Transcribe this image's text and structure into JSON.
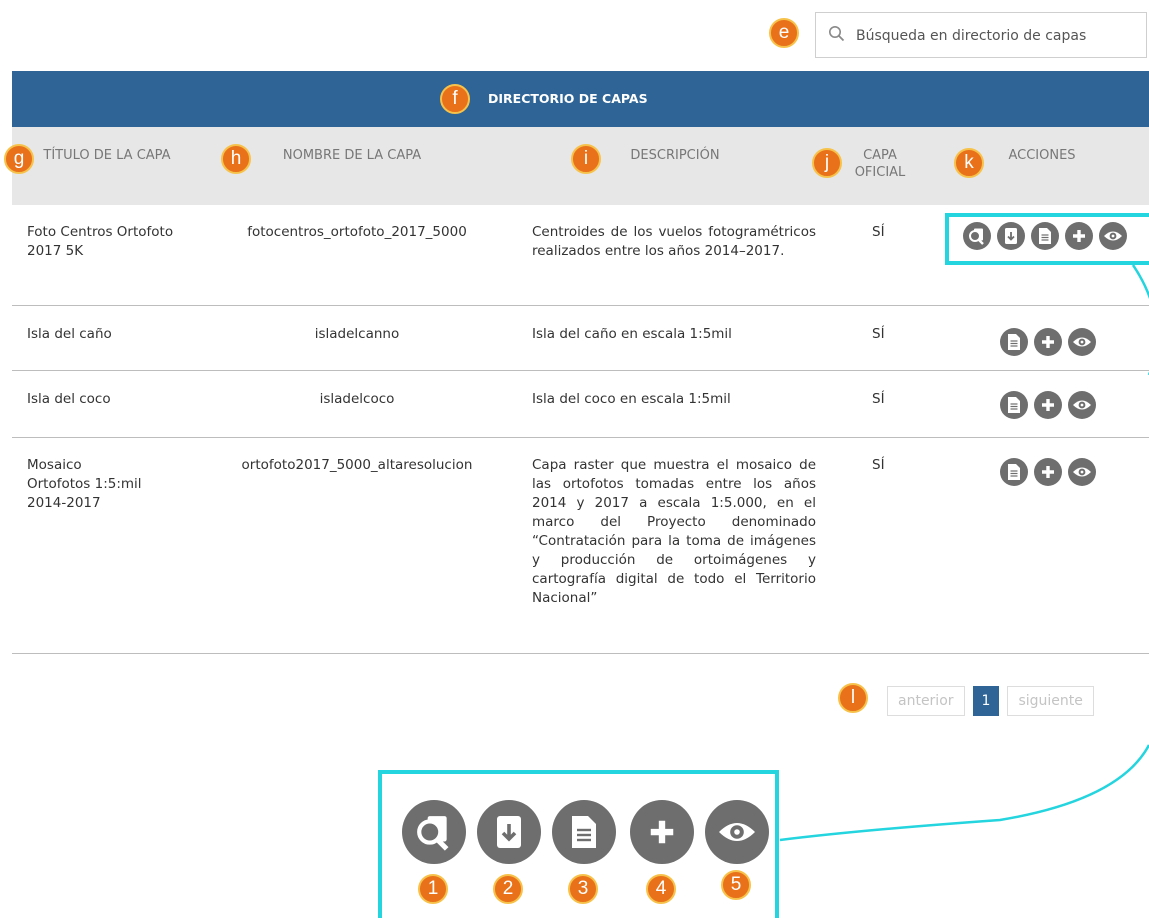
{
  "search": {
    "placeholder": "Búsqueda en directorio de capas",
    "value": ""
  },
  "directory": {
    "title": "DIRECTORIO DE CAPAS"
  },
  "columns": {
    "title": "TÍTULO DE LA CAPA",
    "name": "NOMBRE DE LA CAPA",
    "description": "DESCRIPCIÓN",
    "official": "CAPA OFICIAL",
    "actions": "ACCIONES"
  },
  "rows": [
    {
      "title": "Foto Centros Ortofoto 2017 5K",
      "name": "fotocentros_ortofoto_2017_5000",
      "description": "Centroides de los vuelos fotogramétricos realizados entre los años 2014–2017.",
      "official": "SÍ",
      "actions": [
        "metadata-search",
        "download",
        "document",
        "add",
        "view"
      ]
    },
    {
      "title": "Isla del caño",
      "name": "isladelcanno",
      "description": "Isla del caño en escala 1:5mil",
      "official": "SÍ",
      "actions": [
        "document",
        "add",
        "view"
      ]
    },
    {
      "title": "Isla del coco",
      "name": "isladelcoco",
      "description": "Isla del coco en escala 1:5mil",
      "official": "SÍ",
      "actions": [
        "document",
        "add",
        "view"
      ]
    },
    {
      "title": "Mosaico Ortofotos 1:5:mil 2014-2017",
      "name": "ortofoto2017_5000_altaresolucion",
      "description": "Capa raster que muestra el mosaico de las ortofotos tomadas entre los años 2014 y 2017 a escala 1:5.000, en el marco del Proyecto denominado “Contratación para la toma de imágenes y producción de ortoimágenes y cartografía digital de todo el Territorio Nacional”",
      "official": "SÍ",
      "actions": [
        "document",
        "add",
        "view"
      ]
    }
  ],
  "pagination": {
    "previous": "anterior",
    "current": "1",
    "next": "siguiente"
  },
  "callouts": {
    "e": "e",
    "f": "f",
    "g": "g",
    "h": "h",
    "i": "i",
    "j": "j",
    "k": "k",
    "l": "l",
    "legend": [
      "1",
      "2",
      "3",
      "4",
      "5"
    ]
  },
  "colors": {
    "header_bar": "#2e6496",
    "column_header_bg": "#e7e7e7",
    "action_icon": "#6e6e6e",
    "callout_badge": "#e8711a",
    "highlight": "#24d4de"
  }
}
